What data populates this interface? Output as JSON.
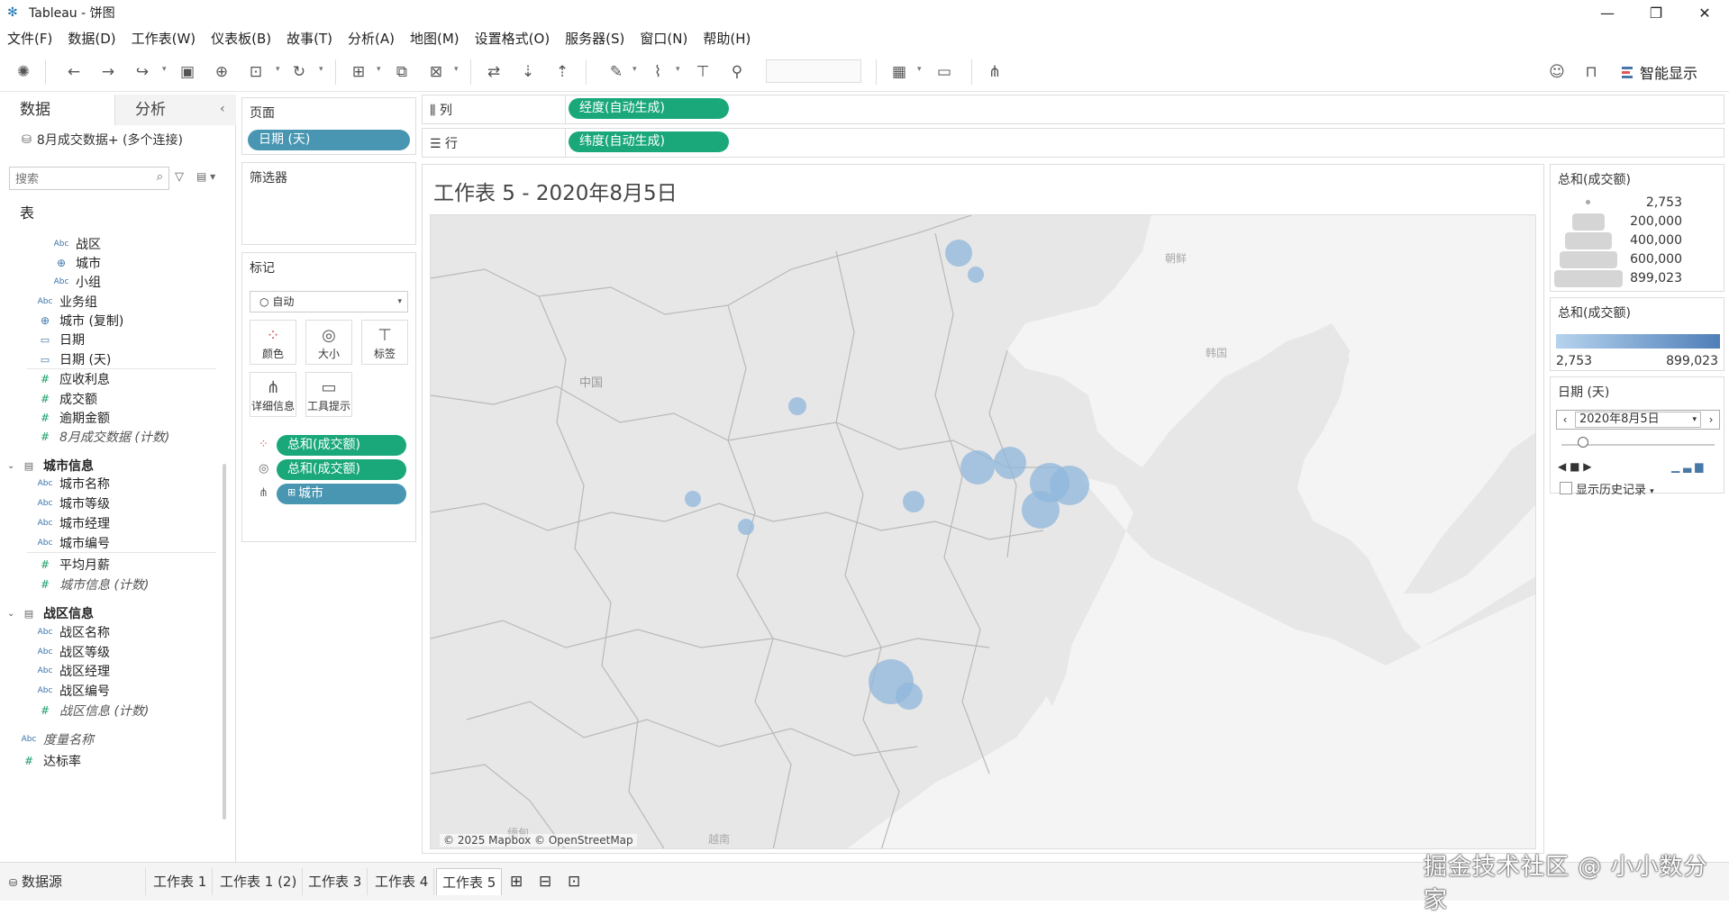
{
  "window": {
    "title": "Tableau - 饼图",
    "minimize": "—",
    "maximize": "❐",
    "close": "✕"
  },
  "menu": [
    "文件(F)",
    "数据(D)",
    "工作表(W)",
    "仪表板(B)",
    "故事(T)",
    "分析(A)",
    "地图(M)",
    "设置格式(O)",
    "服务器(S)",
    "窗口(N)",
    "帮助(H)"
  ],
  "toolbar": {
    "smart_show": "智能显示"
  },
  "left_pane": {
    "tab_data": "数据",
    "tab_analysis": "分析",
    "datasource": "8月成交数据+ (多个连接)",
    "search_placeholder": "搜索",
    "tables_label": "表",
    "fields": [
      {
        "label": "战区",
        "type": "Abc"
      },
      {
        "label": "城市",
        "type": "geo"
      },
      {
        "label": "小组",
        "type": "Abc"
      },
      {
        "label": "业务组",
        "type": "Abc"
      },
      {
        "label": "城市 (复制)",
        "type": "geo"
      },
      {
        "label": "日期",
        "type": "date"
      },
      {
        "label": "日期 (天)",
        "type": "date"
      },
      {
        "label": "应收利息",
        "type": "#"
      },
      {
        "label": "成交额",
        "type": "#"
      },
      {
        "label": "逾期金额",
        "type": "#"
      },
      {
        "label": "8月成交数据 (计数)",
        "type": "#"
      },
      {
        "label": "城市信息",
        "type": "table"
      },
      {
        "label": "城市名称",
        "type": "Abc"
      },
      {
        "label": "城市等级",
        "type": "Abc"
      },
      {
        "label": "城市经理",
        "type": "Abc"
      },
      {
        "label": "城市编号",
        "type": "Abc"
      },
      {
        "label": "平均月薪",
        "type": "#"
      },
      {
        "label": "城市信息 (计数)",
        "type": "#"
      },
      {
        "label": "战区信息",
        "type": "table"
      },
      {
        "label": "战区名称",
        "type": "Abc"
      },
      {
        "label": "战区等级",
        "type": "Abc"
      },
      {
        "label": "战区经理",
        "type": "Abc"
      },
      {
        "label": "战区编号",
        "type": "Abc"
      },
      {
        "label": "战区信息 (计数)",
        "type": "#"
      },
      {
        "label": "度量名称",
        "type": "Abc"
      },
      {
        "label": "达标率",
        "type": "#"
      }
    ]
  },
  "pages": {
    "title": "页面",
    "pill": "日期 (天)"
  },
  "filters": {
    "title": "筛选器"
  },
  "marks": {
    "title": "标记",
    "type": "自动",
    "buttons": [
      "颜色",
      "大小",
      "标签",
      "详细信息",
      "工具提示"
    ],
    "pills": [
      "总和(成交额)",
      "总和(成交额)",
      "城市"
    ]
  },
  "shelves": {
    "columns_label": "列",
    "columns_pill": "经度(自动生成)",
    "rows_label": "行",
    "rows_pill": "纬度(自动生成)"
  },
  "viz": {
    "title": "工作表 5 - 2020年8月5日",
    "attribution": "© 2025 Mapbox © OpenStreetMap",
    "map_labels": [
      "中国",
      "朝鲜",
      "韩国",
      "越南",
      "缅甸"
    ],
    "colors": {
      "bubble": "#8fb7dc",
      "land": "#e7e7e7",
      "water": "#f4f4f4",
      "border": "#b9b9b9"
    }
  },
  "size_legend": {
    "title": "总和(成交额)",
    "values": [
      "2,753",
      "200,000",
      "400,000",
      "600,000",
      "899,023"
    ]
  },
  "color_legend": {
    "title": "总和(成交额)",
    "min": "2,753",
    "max": "899,023"
  },
  "page_control": {
    "title": "日期 (天)",
    "value": "2020年8月5日",
    "show_history": "显示历史记录"
  },
  "sheets": [
    "数据源",
    "工作表 1",
    "工作表 1 (2)",
    "工作表 3",
    "工作表 4",
    "工作表 5"
  ],
  "active_sheet": "工作表 5",
  "watermark": "掘金技术社区 @ 小小数分家"
}
